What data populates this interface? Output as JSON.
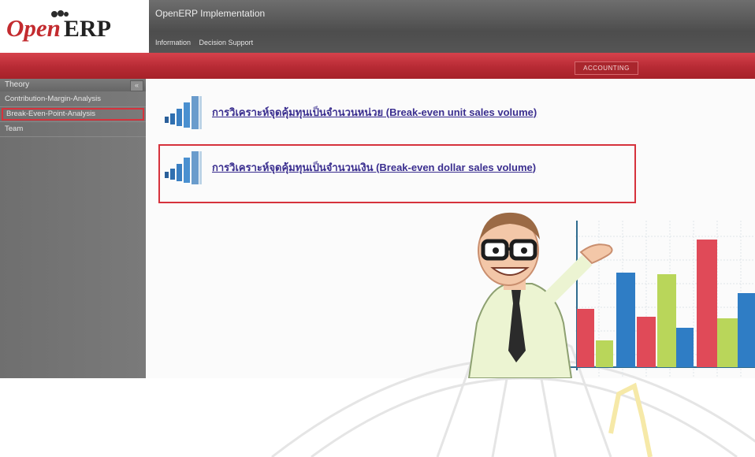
{
  "header": {
    "logo_open": "Open",
    "logo_erp": "ERP",
    "app_title": "OpenERP Implementation",
    "menu": [
      "Information",
      "Decision Support"
    ],
    "module_tab": "ACCOUNTING"
  },
  "sidebar": {
    "heading": "Theory",
    "collapse_label": "«",
    "items": [
      {
        "label": "Contribution-Margin-Analysis"
      },
      {
        "label": "Break-Even-Point-Analysis"
      },
      {
        "label": "Team"
      }
    ]
  },
  "content": {
    "links": [
      {
        "label": "การวิเคราะห์จุดคุ้มทุนเป็นจำนวนหน่วย (Break-even unit sales volume)"
      },
      {
        "label": "การวิเคราะห์จุดคุ้มทุนเป็นจำนวนเงิน (Break-even dollar sales volume)"
      }
    ]
  },
  "colors": {
    "accent_red": "#b72a34",
    "link": "#3a2e8f",
    "sidebar": "#737373",
    "highlight": "#d6323c"
  },
  "icons": [
    "bar-graph-icon",
    "collapse-icon"
  ]
}
